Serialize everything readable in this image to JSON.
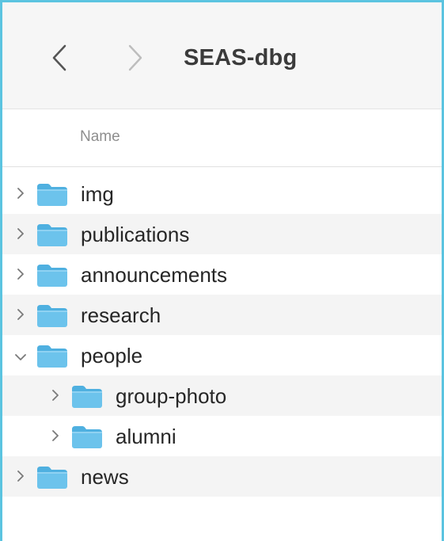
{
  "window": {
    "title": "SEAS-dbg"
  },
  "toolbar": {
    "back_icon": "chevron-left-icon",
    "forward_icon": "chevron-right-icon"
  },
  "columns": {
    "name": "Name"
  },
  "colors": {
    "accent_border": "#5bc4e0",
    "folder_body": "#6cc3ec",
    "folder_tab": "#4fb0e0"
  },
  "items": [
    {
      "name": "img",
      "expanded": false,
      "level": 0
    },
    {
      "name": "publications",
      "expanded": false,
      "level": 0
    },
    {
      "name": "announcements",
      "expanded": false,
      "level": 0
    },
    {
      "name": "research",
      "expanded": false,
      "level": 0
    },
    {
      "name": "people",
      "expanded": true,
      "level": 0
    },
    {
      "name": "group-photo",
      "expanded": false,
      "level": 1
    },
    {
      "name": "alumni",
      "expanded": false,
      "level": 1
    },
    {
      "name": "news",
      "expanded": false,
      "level": 0
    }
  ]
}
